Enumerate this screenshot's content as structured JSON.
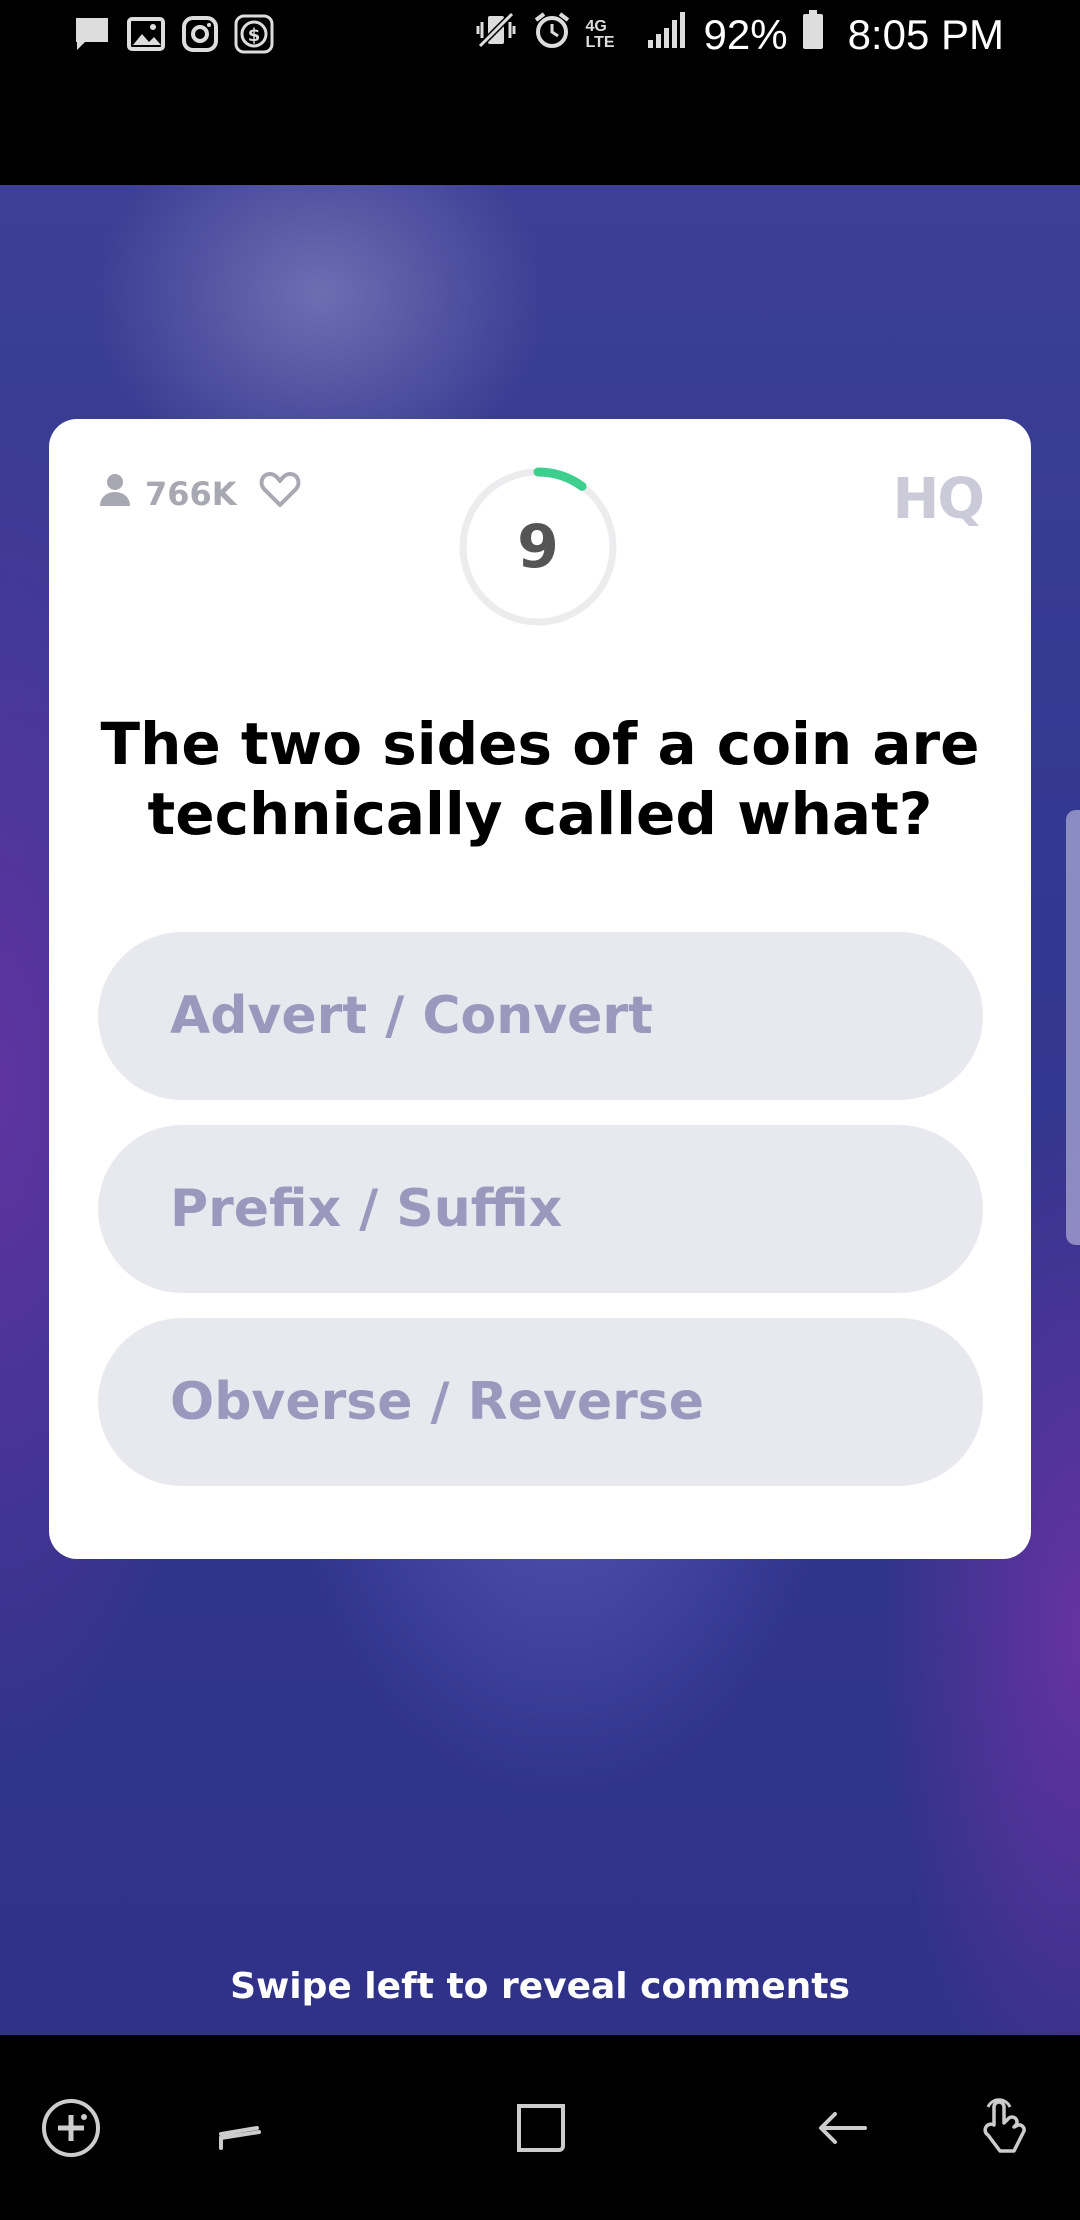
{
  "status_bar": {
    "battery_percent": "92%",
    "time": "8:05 PM",
    "network": "4G LTE",
    "left_icons": [
      "message-icon",
      "image-icon",
      "instagram-icon",
      "money-icon"
    ],
    "right_icons": [
      "vibrate-icon",
      "alarm-icon",
      "4g-lte-icon",
      "signal-icon",
      "battery-icon"
    ]
  },
  "game": {
    "viewer_count": "766K",
    "countdown": "9",
    "timer_progress": 0.1,
    "logo": "HQ",
    "question": "The two sides of a coin are technically called what?",
    "answers": [
      {
        "label": "Advert / Convert"
      },
      {
        "label": "Prefix / Suffix"
      },
      {
        "label": "Obverse / Reverse"
      }
    ]
  },
  "hint": "Swipe left to reveal comments",
  "nav_bar": {
    "buttons": [
      "game-tools-icon",
      "recent-apps-icon",
      "home-icon",
      "back-icon",
      "touch-assist-icon"
    ]
  },
  "colors": {
    "accent_timer": "#3ecf8e",
    "answer_bg": "#e8e8ef",
    "answer_text": "#9a98bd",
    "background": "#34378f"
  }
}
